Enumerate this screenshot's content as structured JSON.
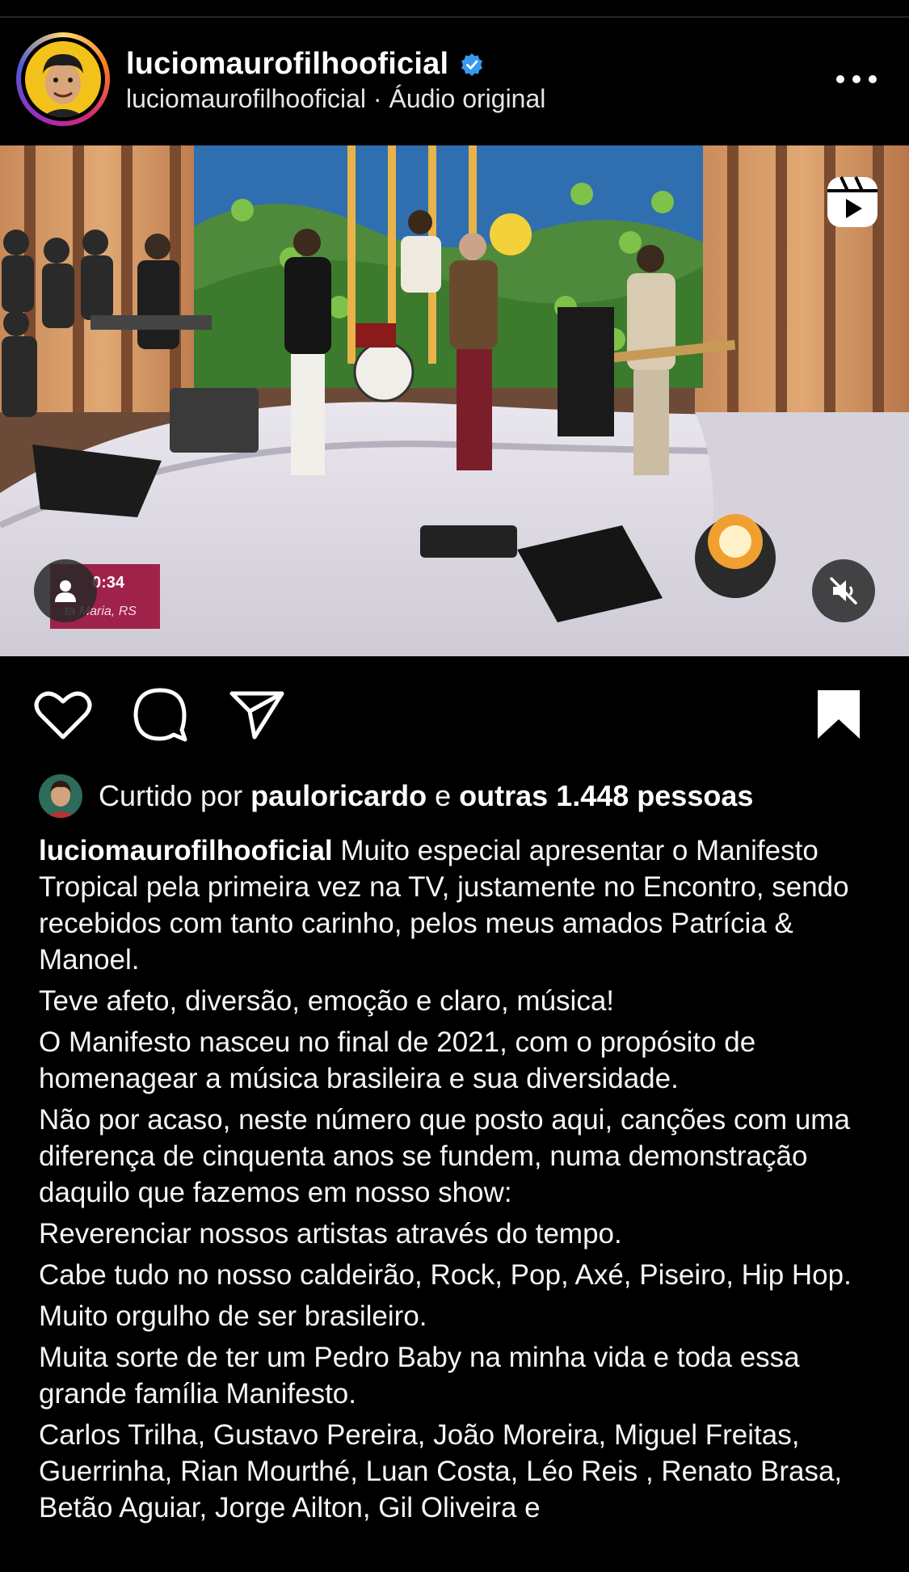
{
  "header": {
    "username": "luciomaurofilhooficial",
    "subline": "luciomaurofilhooficial · Áudio original"
  },
  "media": {
    "overlay_time": "0:34",
    "overlay_place": "ta Maria, RS"
  },
  "likes": {
    "prefix": "Curtido por ",
    "liker": "pauloricardo",
    "middle": " e ",
    "others": "outras 1.448 pessoas"
  },
  "caption": {
    "username": "luciomaurofilhooficial",
    "first": " Muito especial apresentar o Manifesto Tropical pela primeira vez na TV, justamente no Encontro, sendo recebidos com tanto carinho, pelos meus amados Patrícia & Manoel.",
    "lines": [
      "Teve afeto, diversão, emoção e claro, música!",
      "O Manifesto nasceu no final de 2021, com o propósito de homenagear a música brasileira e sua diversidade.",
      "Não por acaso, neste número que posto aqui, canções com uma diferença de cinquenta anos se fundem, numa demonstração daquilo que fazemos em nosso show:",
      "Reverenciar nossos artistas através do tempo.",
      "Cabe tudo no nosso caldeirão, Rock, Pop, Axé, Piseiro, Hip Hop.",
      "Muito orgulho de ser brasileiro.",
      "Muita sorte de ter um Pedro Baby na minha vida e toda essa grande família Manifesto.",
      "Carlos Trilha, Gustavo Pereira, João Moreira, Miguel Freitas, Guerrinha, Rian Mourthé,  Luan Costa, Léo Reis , Renato Brasa, Betão Aguiar, Jorge Ailton, Gil Oliveira e"
    ]
  },
  "colors": {
    "background": "#000000",
    "verified": "#3897f0",
    "lower_third": "#a0214a"
  },
  "icons": [
    "more-icon",
    "reels-icon",
    "tag-user-icon",
    "mute-icon",
    "heart-icon",
    "comment-icon",
    "share-icon",
    "bookmark-icon",
    "verified-icon"
  ]
}
